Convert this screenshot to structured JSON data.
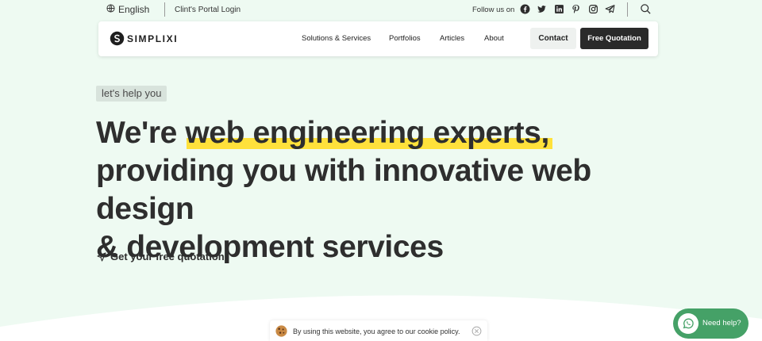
{
  "topbar": {
    "language": "English",
    "portal_link": "Clint's Portal Login",
    "follow_label": "Follow us on",
    "social_icons": [
      "facebook-icon",
      "twitter-icon",
      "linkedin-icon",
      "pinterest-icon",
      "instagram-icon",
      "telegram-icon"
    ]
  },
  "nav": {
    "logo_text": "SIMPLIXI",
    "items": [
      "Solutions & Services",
      "Portfolios",
      "Articles",
      "About"
    ],
    "contact_label": "Contact",
    "quote_label": "Free Quotation"
  },
  "hero": {
    "tag": "let's help you",
    "headline_prefix": "We're ",
    "headline_highlight": "web engineering experts,",
    "headline_line2": "providing you with innovative web design",
    "headline_line3": "& development services",
    "cta": "Get your free quotation"
  },
  "cookie": {
    "text": "By using this website, you agree to our cookie policy."
  },
  "help": {
    "label": "Need help?"
  },
  "colors": {
    "background": "#eefaf2",
    "highlight": "#ffe13b",
    "dark_button": "#2a2a2a",
    "help_green": "#45a167"
  }
}
